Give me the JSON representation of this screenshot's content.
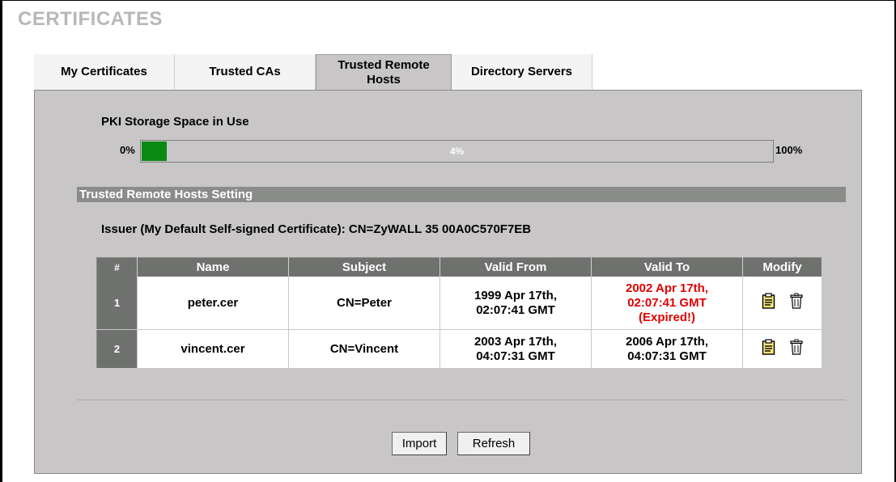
{
  "page": {
    "title": "CERTIFICATES"
  },
  "tabs": [
    {
      "label": "My Certificates"
    },
    {
      "label": "Trusted CAs"
    },
    {
      "label": "Trusted Remote Hosts",
      "active": true
    },
    {
      "label": "Directory Servers"
    }
  ],
  "pki": {
    "label": "PKI Storage Space in Use",
    "min_label": "0%",
    "max_label": "100%",
    "usage_text": "4%",
    "usage_fraction": 0.04,
    "fill_color": "#0a8a12"
  },
  "section": {
    "header": "Trusted Remote Hosts Setting"
  },
  "issuer": {
    "text": "Issuer (My Default Self-signed Certificate): CN=ZyWALL 35 00A0C570F7EB"
  },
  "table": {
    "headers": {
      "num": "#",
      "name": "Name",
      "subject": "Subject",
      "valid_from": "Valid From",
      "valid_to": "Valid To",
      "modify": "Modify"
    },
    "rows": [
      {
        "num": "1",
        "name": "peter.cer",
        "subject": "CN=Peter",
        "valid_from_1": "1999 Apr 17th,",
        "valid_from_2": "02:07:41 GMT",
        "valid_to_1": "2002 Apr 17th,",
        "valid_to_2": "02:07:41 GMT",
        "valid_to_3": "(Expired!)",
        "expired": true,
        "edit_icon": "edit-icon",
        "delete_icon": "trash-icon"
      },
      {
        "num": "2",
        "name": "vincent.cer",
        "subject": "CN=Vincent",
        "valid_from_1": "2003 Apr 17th,",
        "valid_from_2": "04:07:31 GMT",
        "valid_to_1": "2006 Apr 17th,",
        "valid_to_2": "04:07:31 GMT",
        "expired": false,
        "edit_icon": "edit-icon",
        "delete_icon": "trash-icon"
      }
    ]
  },
  "buttons": {
    "import": "Import",
    "refresh": "Refresh"
  },
  "colors": {
    "expired": "#e00000",
    "panel": "#c8c6c6",
    "header_bg": "#6f716f",
    "title": "#b8b8b8"
  }
}
